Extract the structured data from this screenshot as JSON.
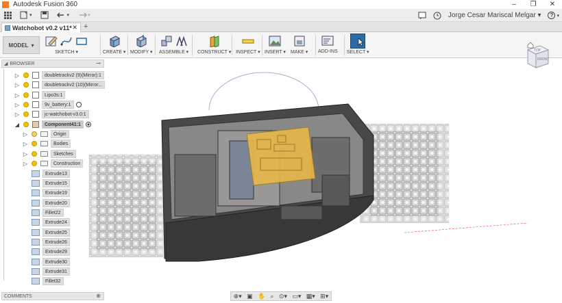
{
  "app": {
    "title": "Autodesk Fusion 360",
    "window_controls": [
      "–",
      "❐",
      "✕"
    ]
  },
  "qat": {
    "user_name": "Jorge Cesar Mariscal Melgar ▾",
    "help_label": "?"
  },
  "document_tab": {
    "name": "Watchobot v0.2 v11*",
    "close_label": "✕",
    "add_label": "+"
  },
  "toolbar": {
    "mode": "MODEL",
    "groups": [
      {
        "label": "SKETCH ▾"
      },
      {
        "label": "CREATE ▾"
      },
      {
        "label": "MODIFY ▾"
      },
      {
        "label": "ASSEMBLE ▾"
      },
      {
        "label": "CONSTRUCT ▾"
      },
      {
        "label": "INSPECT ▾"
      },
      {
        "label": "INSERT ▾"
      },
      {
        "label": "MAKE ▾"
      },
      {
        "label": "ADD-INS"
      },
      {
        "label": "SELECT ▾"
      }
    ]
  },
  "browser": {
    "title": "BROWSER",
    "items": [
      {
        "label": "doubletrackv2 (9)(Mirror):1"
      },
      {
        "label": "doubletrackv2 (10)(Mirror..."
      },
      {
        "label": "Lipo3s:1"
      },
      {
        "label": "9v_battery:1"
      },
      {
        "label": "jc-watchobot-v3.0:1"
      },
      {
        "label": "Component41:1"
      },
      {
        "label": "Origin"
      },
      {
        "label": "Bodies"
      },
      {
        "label": "Sketches"
      },
      {
        "label": "Construction"
      },
      {
        "label": "Extrude13"
      },
      {
        "label": "Extrude15"
      },
      {
        "label": "Extrude19"
      },
      {
        "label": "Extrude20"
      },
      {
        "label": "Fillet22"
      },
      {
        "label": "Extrude24"
      },
      {
        "label": "Extrude25"
      },
      {
        "label": "Extrude26"
      },
      {
        "label": "Extrude29"
      },
      {
        "label": "Extrude30"
      },
      {
        "label": "Extrude31"
      },
      {
        "label": "Fillet32"
      }
    ]
  },
  "comments": {
    "title": "COMMENTS"
  },
  "viewcube": {
    "top": "TOP",
    "front": "FRONT"
  },
  "colors": {
    "accent": "#2b6ca3",
    "model_body": "#4a4846",
    "highlight_board": "#e8b84a",
    "bulb": "#f2c200"
  }
}
